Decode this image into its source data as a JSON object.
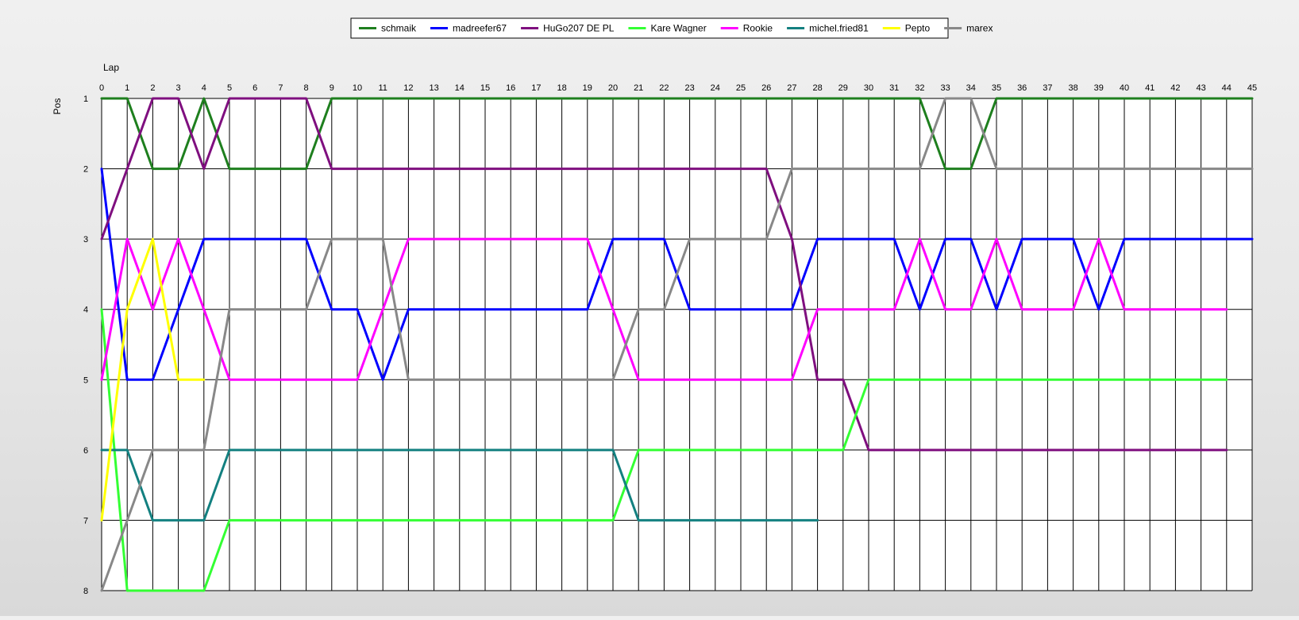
{
  "chart_data": {
    "type": "line",
    "title": "",
    "xlabel": "Lap",
    "ylabel": "Pos",
    "xlim": [
      0,
      45
    ],
    "ylim": [
      1,
      8
    ],
    "y_inverted": true,
    "grid": true,
    "legend_position": "top-center",
    "x_ticks": [
      0,
      1,
      2,
      3,
      4,
      5,
      6,
      7,
      8,
      9,
      10,
      11,
      12,
      13,
      14,
      15,
      16,
      17,
      18,
      19,
      20,
      21,
      22,
      23,
      24,
      25,
      26,
      27,
      28,
      29,
      30,
      31,
      32,
      33,
      34,
      35,
      36,
      37,
      38,
      39,
      40,
      41,
      42,
      43,
      44,
      45
    ],
    "y_ticks": [
      1,
      2,
      3,
      4,
      5,
      6,
      7,
      8
    ],
    "series": [
      {
        "name": "schmaik",
        "color": "#1e7f1e",
        "x": [
          0,
          1,
          2,
          3,
          4,
          5,
          6,
          7,
          8,
          9,
          10,
          11,
          12,
          13,
          14,
          15,
          16,
          17,
          18,
          19,
          20,
          21,
          22,
          23,
          24,
          25,
          26,
          27,
          28,
          29,
          30,
          31,
          32,
          33,
          34,
          35,
          36,
          37,
          38,
          39,
          40,
          41,
          42,
          43,
          44,
          45
        ],
        "y": [
          1,
          1,
          2,
          2,
          1,
          2,
          2,
          2,
          2,
          1,
          1,
          1,
          1,
          1,
          1,
          1,
          1,
          1,
          1,
          1,
          1,
          1,
          1,
          1,
          1,
          1,
          1,
          1,
          1,
          1,
          1,
          1,
          1,
          2,
          2,
          1,
          1,
          1,
          1,
          1,
          1,
          1,
          1,
          1,
          1,
          1
        ]
      },
      {
        "name": "madreefer67",
        "color": "#0000ff",
        "x": [
          0,
          1,
          2,
          3,
          4,
          5,
          6,
          7,
          8,
          9,
          10,
          11,
          12,
          13,
          14,
          15,
          16,
          17,
          18,
          19,
          20,
          21,
          22,
          23,
          24,
          25,
          26,
          27,
          28,
          29,
          30,
          31,
          32,
          33,
          34,
          35,
          36,
          37,
          38,
          39,
          40,
          41,
          42,
          43,
          44,
          45
        ],
        "y": [
          2,
          5,
          5,
          4,
          3,
          3,
          3,
          3,
          3,
          4,
          4,
          5,
          4,
          4,
          4,
          4,
          4,
          4,
          4,
          4,
          3,
          3,
          3,
          4,
          4,
          4,
          4,
          4,
          3,
          3,
          3,
          3,
          4,
          3,
          3,
          4,
          3,
          3,
          3,
          4,
          3,
          3,
          3,
          3,
          3,
          3
        ]
      },
      {
        "name": "HuGo207 DE PL",
        "color": "#7f0f7f",
        "x": [
          0,
          1,
          2,
          3,
          4,
          5,
          6,
          7,
          8,
          9,
          10,
          11,
          12,
          13,
          14,
          15,
          16,
          17,
          18,
          19,
          20,
          21,
          22,
          23,
          24,
          25,
          26,
          27,
          28,
          29,
          30,
          31,
          32,
          33,
          34,
          35,
          36,
          37,
          38,
          39,
          40,
          41,
          42,
          43,
          44
        ],
        "y": [
          3,
          2,
          1,
          1,
          2,
          1,
          1,
          1,
          1,
          2,
          2,
          2,
          2,
          2,
          2,
          2,
          2,
          2,
          2,
          2,
          2,
          2,
          2,
          2,
          2,
          2,
          2,
          3,
          5,
          5,
          6,
          6,
          6,
          6,
          6,
          6,
          6,
          6,
          6,
          6,
          6,
          6,
          6,
          6,
          6
        ]
      },
      {
        "name": "Kare Wagner",
        "color": "#33ff33",
        "x": [
          0,
          1,
          2,
          3,
          4,
          5,
          6,
          7,
          8,
          9,
          10,
          11,
          12,
          13,
          14,
          15,
          16,
          17,
          18,
          19,
          20,
          21,
          22,
          23,
          24,
          25,
          26,
          27,
          28,
          29,
          30,
          31,
          32,
          33,
          34,
          35,
          36,
          37,
          38,
          39,
          40,
          41,
          42,
          43,
          44
        ],
        "y": [
          4,
          8,
          8,
          8,
          8,
          7,
          7,
          7,
          7,
          7,
          7,
          7,
          7,
          7,
          7,
          7,
          7,
          7,
          7,
          7,
          7,
          6,
          6,
          6,
          6,
          6,
          6,
          6,
          6,
          6,
          5,
          5,
          5,
          5,
          5,
          5,
          5,
          5,
          5,
          5,
          5,
          5,
          5,
          5,
          5
        ]
      },
      {
        "name": "Rookie",
        "color": "#ff00ff",
        "x": [
          0,
          1,
          2,
          3,
          4,
          5,
          6,
          7,
          8,
          9,
          10,
          11,
          12,
          13,
          14,
          15,
          16,
          17,
          18,
          19,
          20,
          21,
          22,
          23,
          24,
          25,
          26,
          27,
          28,
          29,
          30,
          31,
          32,
          33,
          34,
          35,
          36,
          37,
          38,
          39,
          40,
          41,
          42,
          43,
          44
        ],
        "y": [
          5,
          3,
          4,
          3,
          4,
          5,
          5,
          5,
          5,
          5,
          5,
          4,
          3,
          3,
          3,
          3,
          3,
          3,
          3,
          3,
          4,
          5,
          5,
          5,
          5,
          5,
          5,
          5,
          4,
          4,
          4,
          4,
          3,
          4,
          4,
          3,
          4,
          4,
          4,
          3,
          4,
          4,
          4,
          4,
          4
        ]
      },
      {
        "name": "michel.fried81",
        "color": "#138080",
        "x": [
          0,
          1,
          2,
          3,
          4,
          5,
          6,
          7,
          8,
          9,
          10,
          11,
          12,
          13,
          14,
          15,
          16,
          17,
          18,
          19,
          20,
          21,
          22,
          23,
          24,
          25,
          26,
          27,
          28
        ],
        "y": [
          6,
          6,
          7,
          7,
          7,
          6,
          6,
          6,
          6,
          6,
          6,
          6,
          6,
          6,
          6,
          6,
          6,
          6,
          6,
          6,
          6,
          7,
          7,
          7,
          7,
          7,
          7,
          7,
          7
        ]
      },
      {
        "name": "Pepto",
        "color": "#ffff00",
        "x": [
          0,
          1,
          2,
          3,
          4
        ],
        "y": [
          7,
          4,
          3,
          5,
          5
        ]
      },
      {
        "name": "marex",
        "color": "#888888",
        "x": [
          0,
          1,
          2,
          3,
          4,
          5,
          6,
          7,
          8,
          9,
          10,
          11,
          12,
          13,
          14,
          15,
          16,
          17,
          18,
          19,
          20,
          21,
          22,
          23,
          24,
          25,
          26,
          27,
          28,
          29,
          30,
          31,
          32,
          33,
          34,
          35,
          36,
          37,
          38,
          39,
          40,
          41,
          42,
          43,
          44,
          45
        ],
        "y": [
          8,
          7,
          6,
          6,
          6,
          4,
          4,
          4,
          4,
          3,
          3,
          3,
          5,
          5,
          5,
          5,
          5,
          5,
          5,
          5,
          5,
          4,
          4,
          3,
          3,
          3,
          3,
          2,
          2,
          2,
          2,
          2,
          2,
          1,
          1,
          2,
          2,
          2,
          2,
          2,
          2,
          2,
          2,
          2,
          2,
          2
        ]
      }
    ]
  }
}
